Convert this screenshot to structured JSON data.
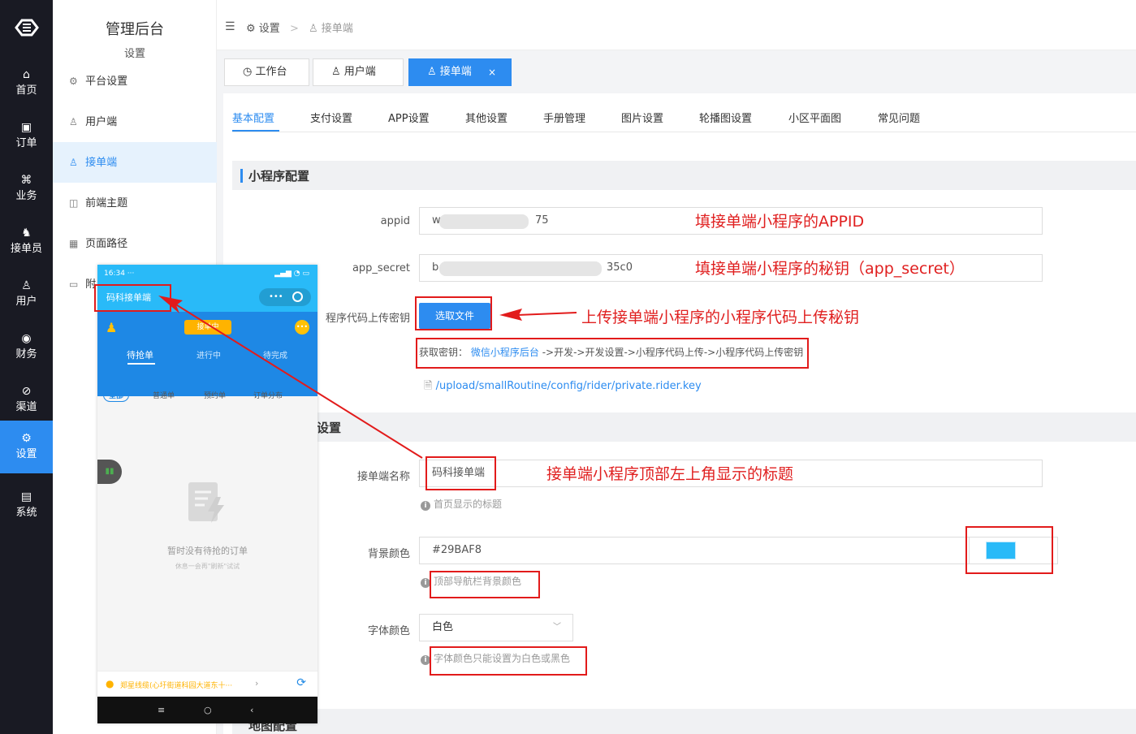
{
  "nav": {
    "items": [
      {
        "label": "首页",
        "icon": "⌂"
      },
      {
        "label": "订单",
        "icon": "▣"
      },
      {
        "label": "业务",
        "icon": "⌘"
      },
      {
        "label": "接单员",
        "icon": "♞"
      },
      {
        "label": "用户",
        "icon": "♙"
      },
      {
        "label": "财务",
        "icon": "◉"
      },
      {
        "label": "渠道",
        "icon": "⊘"
      },
      {
        "label": "设置",
        "icon": "⚙"
      },
      {
        "label": "系统",
        "icon": "▤"
      }
    ],
    "active_color": "#2d8cf0"
  },
  "sidebar": {
    "title": "管理后台",
    "subtitle": "设置",
    "items": [
      {
        "label": "平台设置",
        "icon": "⚙"
      },
      {
        "label": "用户端",
        "icon": "♙"
      },
      {
        "label": "接单端",
        "icon": "♙"
      },
      {
        "label": "前端主题",
        "icon": "◫"
      },
      {
        "label": "页面路径",
        "icon": "▦"
      },
      {
        "label": "附",
        "icon": "▭"
      }
    ]
  },
  "breadcrumb": {
    "items": [
      "设置",
      "接单端"
    ],
    "separator": ">"
  },
  "tabs": [
    {
      "label": "工作台",
      "icon": "◷"
    },
    {
      "label": "用户端",
      "icon": "♙"
    },
    {
      "label": "接单端",
      "icon": "♙",
      "close": "×"
    }
  ],
  "settings_tabs": [
    "基本配置",
    "支付设置",
    "APP设置",
    "其他设置",
    "手册管理",
    "图片设置",
    "轮播图设置",
    "小区平面图",
    "常见问题"
  ],
  "section1": {
    "title": "小程序配置",
    "appid_label": "appid",
    "appid_prefix": "w",
    "appid_suffix": "75",
    "secret_label": "app_secret",
    "secret_prefix": "b",
    "secret_suffix": "35c0",
    "upload_label": "程序代码上传密钥",
    "upload_button": "选取文件",
    "key_hint_prefix": "获取密钥：",
    "key_hint_link": "微信小程序后台",
    "key_hint_path": "->开发->开发设置->小程序代码上传->小程序代码上传密钥",
    "file_path": "/upload/smallRoutine/config/rider/private.rider.key"
  },
  "section2": {
    "title_fragment": "设置",
    "name_label": "接单端名称",
    "name_value": "码科接单端",
    "name_hint": "首页显示的标题",
    "bg_label": "背景颜色",
    "bg_value": "#29BAF8",
    "bg_hint": "顶部导航栏背景颜色",
    "font_label": "字体颜色",
    "font_value": "白色",
    "font_hint": "字体颜色只能设置为白色或黑色",
    "bottom_fragment": "地图配置"
  },
  "annotations": {
    "appid": "填接单端小程序的APPID",
    "secret": "填接单端小程序的秘钥（app_secret）",
    "upload": "上传接单端小程序的小程序代码上传秘钥",
    "title": "接单端小程序顶部左上角显示的标题"
  },
  "phone": {
    "time": "16:34 ···",
    "title": "码科接单端",
    "status_pill": "接单中",
    "tabs": [
      "待抢单",
      "进行中",
      "待完成"
    ],
    "filters": [
      "全部",
      "普通单",
      "预约单",
      "订单分布"
    ],
    "empty_title": "暂时没有待抢的订单",
    "empty_sub": "休息一会再\"刷新\"试试",
    "address": "郑星线缆(心圩街道科园大道东十···",
    "nav_keys": [
      "≡",
      "○",
      "‹"
    ]
  },
  "colors": {
    "brand": "#2d8cf0",
    "annotation": "#e21b1b",
    "swatch": "#29BAF8"
  }
}
